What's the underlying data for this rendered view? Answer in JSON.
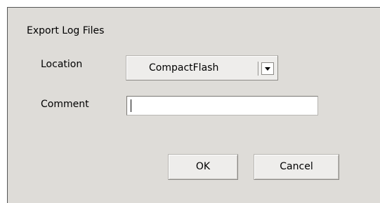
{
  "dialog": {
    "title": "Export Log Files",
    "location": {
      "label": "Location",
      "selected": "CompactFlash"
    },
    "comment": {
      "label": "Comment",
      "value": ""
    },
    "buttons": {
      "ok": "OK",
      "cancel": "Cancel"
    }
  },
  "icons": {
    "dropdown": "chevron-down-icon"
  },
  "colors": {
    "dialog_bg": "#dedcd8",
    "button_bg": "#eeedeb"
  }
}
